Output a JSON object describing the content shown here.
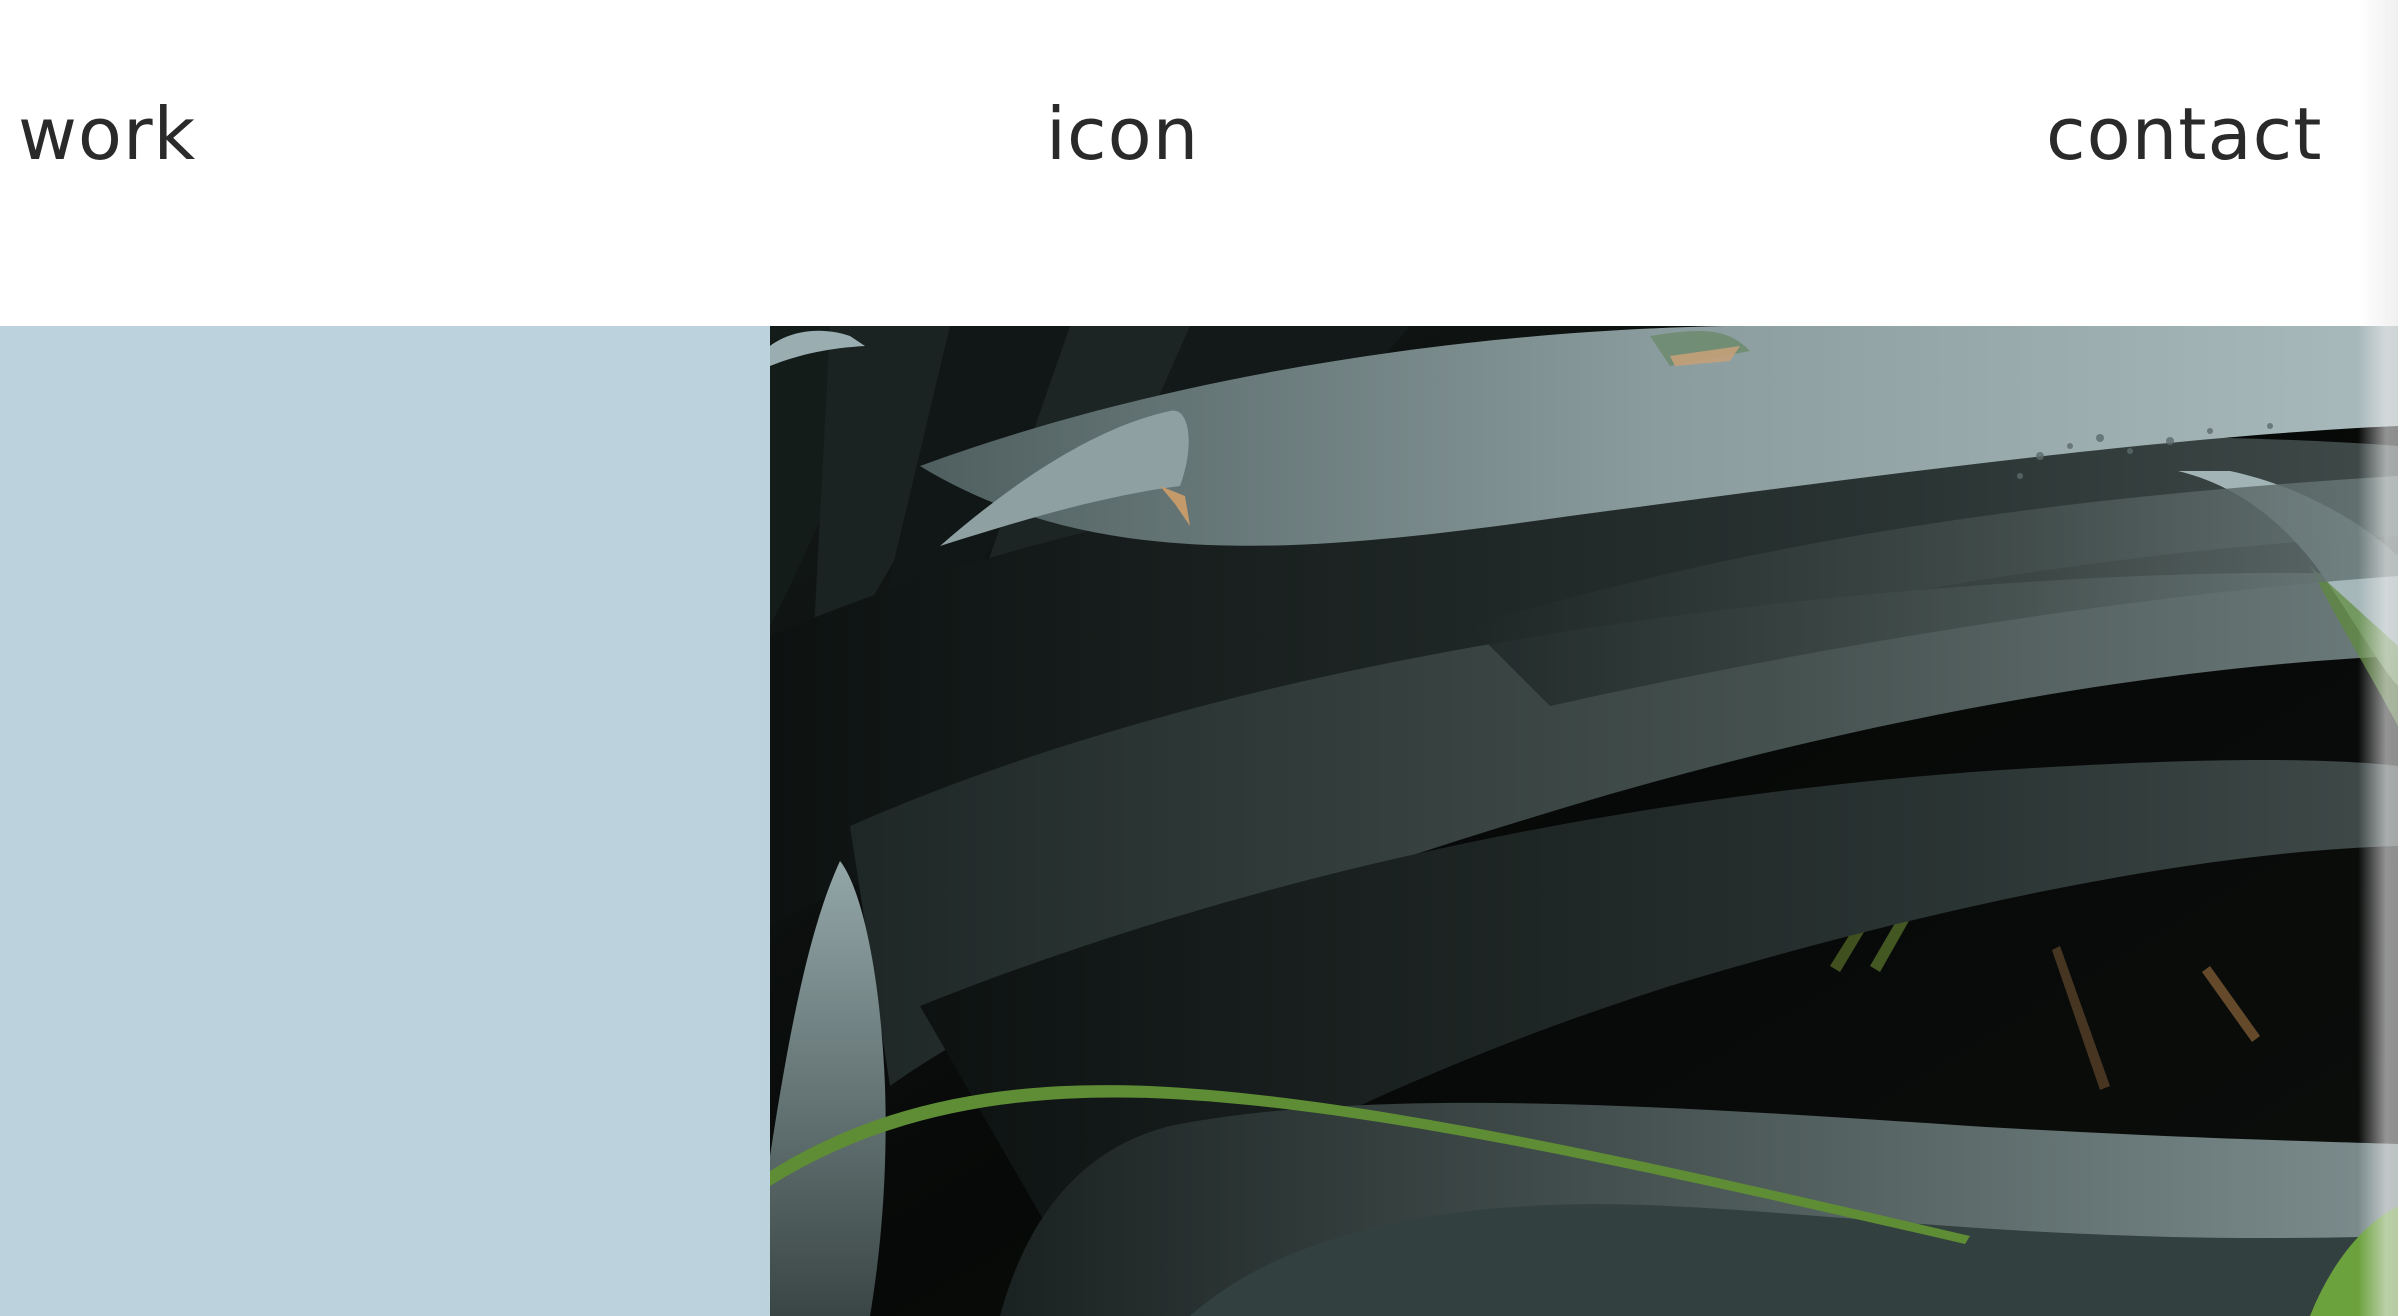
{
  "nav": {
    "work_label": "work",
    "icon_label": "icon",
    "contact_label": "contact"
  },
  "colors": {
    "background": "#ffffff",
    "nav_text": "#2a2a2a",
    "panel_blue": "#bcd3de",
    "photo_dark": "#0a0d0c",
    "leaf_light": "#9fb1b3",
    "leaf_mid": "#5e6f6f",
    "leaf_dark": "#2b3534",
    "grass_green": "#6c9a3e"
  },
  "photo": {
    "subject": "dark-green-agave-leaves"
  }
}
